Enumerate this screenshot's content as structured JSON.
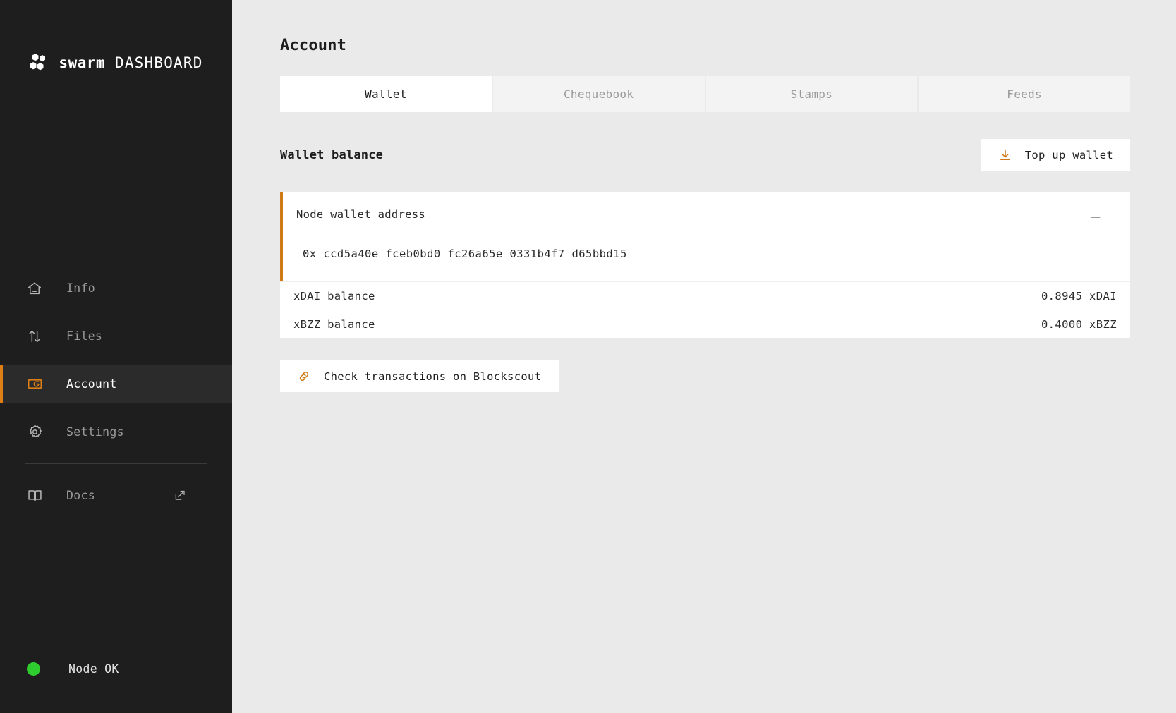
{
  "sidebar": {
    "logo": {
      "mark_icon": "swarm-hexagon-logo-icon",
      "brand": "swarm",
      "sub": " DASHBOARD"
    },
    "items": [
      {
        "label": "Info",
        "icon": "home-icon",
        "active": false
      },
      {
        "label": "Files",
        "icon": "updown-arrows-icon",
        "active": false
      },
      {
        "label": "Account",
        "icon": "wallet-icon",
        "active": true
      },
      {
        "label": "Settings",
        "icon": "gear-icon",
        "active": false
      },
      {
        "label": "Docs",
        "icon": "book-icon",
        "active": false,
        "external_icon": "external-link-icon"
      }
    ],
    "status": {
      "label": "Node OK",
      "dot_color": "#2fcc2f"
    }
  },
  "main": {
    "page_title": "Account",
    "tabs": [
      {
        "label": "Wallet",
        "active": true
      },
      {
        "label": "Chequebook",
        "active": false
      },
      {
        "label": "Stamps",
        "active": false
      },
      {
        "label": "Feeds",
        "active": false
      }
    ],
    "section": {
      "title": "Wallet balance",
      "topup_button": {
        "label": "Top up wallet",
        "icon": "download-arrow-icon"
      }
    },
    "wallet_card": {
      "title": "Node wallet address",
      "address": "0x ccd5a40e fceb0bd0 fc26a65e 0331b4f7 d65bbd15",
      "collapse_icon": "minus-icon",
      "accent_color": "#cf7a17"
    },
    "balances": [
      {
        "label": "xDAI balance",
        "value": "0.8945 xDAI"
      },
      {
        "label": "xBZZ balance",
        "value": "0.4000 xBZZ"
      }
    ],
    "blockscout_button": {
      "label": "Check transactions on Blockscout",
      "icon": "link-chain-icon"
    }
  },
  "theme": {
    "accent": "#dd7e17",
    "sidebar_bg": "#1e1e1e",
    "page_bg": "#eaeaea"
  }
}
